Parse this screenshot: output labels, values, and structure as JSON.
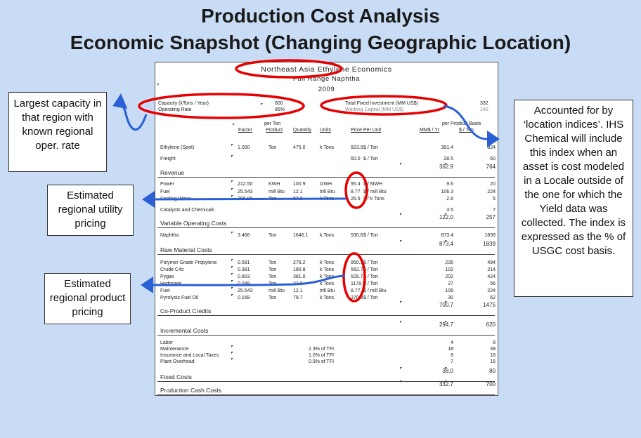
{
  "slide": {
    "title_line1": "Production Cost Analysis",
    "title_line2": "Economic Snapshot (Changing Geographic Location)"
  },
  "sheet": {
    "title": "Northeast Asia Ethylene Economics",
    "subtitle": "Full Range Naphtha",
    "year": "2009",
    "capacity_label": "Capacity (kTons / Year)",
    "capacity_value": "600",
    "operating_rate_label": "Operating Rate",
    "operating_rate_value": "85%",
    "tfi_label": "Total Fixed Investment (MM US$)",
    "tfi_value": "332",
    "working_capital_label": "Working Capital (MM US$)",
    "working_capital_value": "140",
    "col_per_ton": "per Ton",
    "col_per_product_basis": "per Product Basis",
    "col_factor": "Factor",
    "col_product": "Product",
    "col_quantity": "Quantity",
    "col_units": "Units",
    "col_price_per_unit": "Price Per Unit",
    "col_mm_yr": "MM$ / Yr",
    "col_per_ton_usd": "$ / Ton",
    "rows": {
      "ethylene": {
        "label": "Ethylene (Spot)",
        "factor": "1.000",
        "product": "Ton",
        "quantity": "475.0",
        "units": "k Tons",
        "price": "823.9",
        "price_unit": "$ / Ton",
        "mm": "391.4",
        "per_ton": "824"
      },
      "freight": {
        "label": "Freight",
        "price": "60.0",
        "price_unit": "$ / Ton",
        "mm": "28.5",
        "per_ton": "60"
      },
      "revenue": {
        "label": "Revenue",
        "mm": "362.9",
        "per_ton": "764"
      },
      "power": {
        "label": "Power",
        "factor": "212.50",
        "product": "KWH",
        "quantity": "100.9",
        "units": "GWH",
        "price": "95.4",
        "price_unit": "$ / MWH",
        "mm": "9.6",
        "per_ton": "20"
      },
      "fuel": {
        "label": "Fuel",
        "factor": "25.543",
        "product": "mill Btu",
        "quantity": "12.1",
        "units": "trill Btu",
        "price": "8.77",
        "price_unit": "$ / mill Btu",
        "mm": "106.3",
        "per_ton": "224"
      },
      "cooling": {
        "label": "Cooling Water",
        "factor": "206.00",
        "product": "Ton",
        "quantity": "97.9",
        "units": "k Tons",
        "price": "26.6",
        "price_unit": "$ / k Tons",
        "mm": "2.6",
        "per_ton": "5"
      },
      "catalysts": {
        "label": "Catalysts and Chemicals",
        "mm": "3.5",
        "per_ton": "7"
      },
      "variable": {
        "label": "Variable Operating Costs",
        "mm": "122.0",
        "per_ton": "257"
      },
      "naphtha": {
        "label": "Naphtha",
        "factor": "3.466",
        "product": "Ton",
        "quantity": "1646.1",
        "units": "k Tons",
        "price": "530.6",
        "price_unit": "$ / Ton",
        "mm": "873.4",
        "per_ton": "1839"
      },
      "raw": {
        "label": "Raw Material Costs",
        "mm": "873.4",
        "per_ton": "1839"
      },
      "propylene": {
        "label": "Polymer Grade Propylene",
        "factor": "0.581",
        "product": "Ton",
        "quantity": "276.2",
        "units": "k Tons",
        "price": "850.1",
        "price_unit": "$ / Ton",
        "mm": "235",
        "per_ton": "494"
      },
      "c4s": {
        "label": "Crude C4s",
        "factor": "0.381",
        "product": "Ton",
        "quantity": "180.8",
        "units": "k Tons",
        "price": "562.7",
        "price_unit": "$ / Ton",
        "mm": "102",
        "per_ton": "214"
      },
      "pygas": {
        "label": "Pygas",
        "factor": "0.803",
        "product": "Ton",
        "quantity": "381.0",
        "units": "k Tons",
        "price": "528.7",
        "price_unit": "$ / Ton",
        "mm": "202",
        "per_ton": "424"
      },
      "hydrogen": {
        "label": "Hydrogen",
        "factor": "0.048",
        "product": "Ton",
        "quantity": "22.9",
        "units": "k Tons",
        "price": "1178.9",
        "price_unit": "$ / Ton",
        "mm": "27",
        "per_ton": "56"
      },
      "fuel2": {
        "label": "Fuel",
        "factor": "25.543",
        "product": "mill Btu",
        "quantity": "12.1",
        "units": "trill Btu",
        "price": "8.77",
        "price_unit": "$ / mill Btu",
        "mm": "106",
        "per_ton": "224"
      },
      "pyrolysis": {
        "label": "Pyrolysis Fuel Oil",
        "factor": "0.168",
        "product": "Ton",
        "quantity": "79.7",
        "units": "k Tons",
        "price": "370.8",
        "price_unit": "$ / Ton",
        "mm": "30",
        "per_ton": "62"
      },
      "coproduct": {
        "label": "Co-Product Credits",
        "mm": "700.7",
        "per_ton": "1475"
      },
      "incremental": {
        "label": "Incremental Costs",
        "mm": "294.7",
        "per_ton": "620"
      },
      "labor": {
        "label": "Labor",
        "mm": "4",
        "per_ton": "8"
      },
      "maintenance": {
        "label": "Maintenance",
        "pct": "2.3% of TFI",
        "mm": "18",
        "per_ton": "39"
      },
      "insurance": {
        "label": "Insurance and Local Taxes",
        "pct": "1.0% of TFI",
        "mm": "8",
        "per_ton": "18"
      },
      "overhead": {
        "label": "Plant Overhead",
        "pct": "0.9% of TFI",
        "mm": "7",
        "per_ton": "15"
      },
      "fixed": {
        "label": "Fixed Costs",
        "mm": "38.0",
        "per_ton": "80"
      },
      "cash": {
        "label": "Production Cash Costs",
        "mm": "332.7",
        "per_ton": "700"
      }
    }
  },
  "callouts": {
    "capacity": "Largest capacity in that region with known regional oper. rate",
    "utility": "Estimated regional utility pricing",
    "product": "Estimated regional product pricing",
    "location": "Accounted for by ‘location indices’. IHS Chemical will include this index when an asset is cost modeled in a Locale outside of the one for which the Yield data was collected. The index is expressed as the % of USGC cost basis."
  },
  "colors": {
    "background": "#c9dcf5",
    "highlight": "#e60000",
    "arrow": "#2a5fd6"
  }
}
